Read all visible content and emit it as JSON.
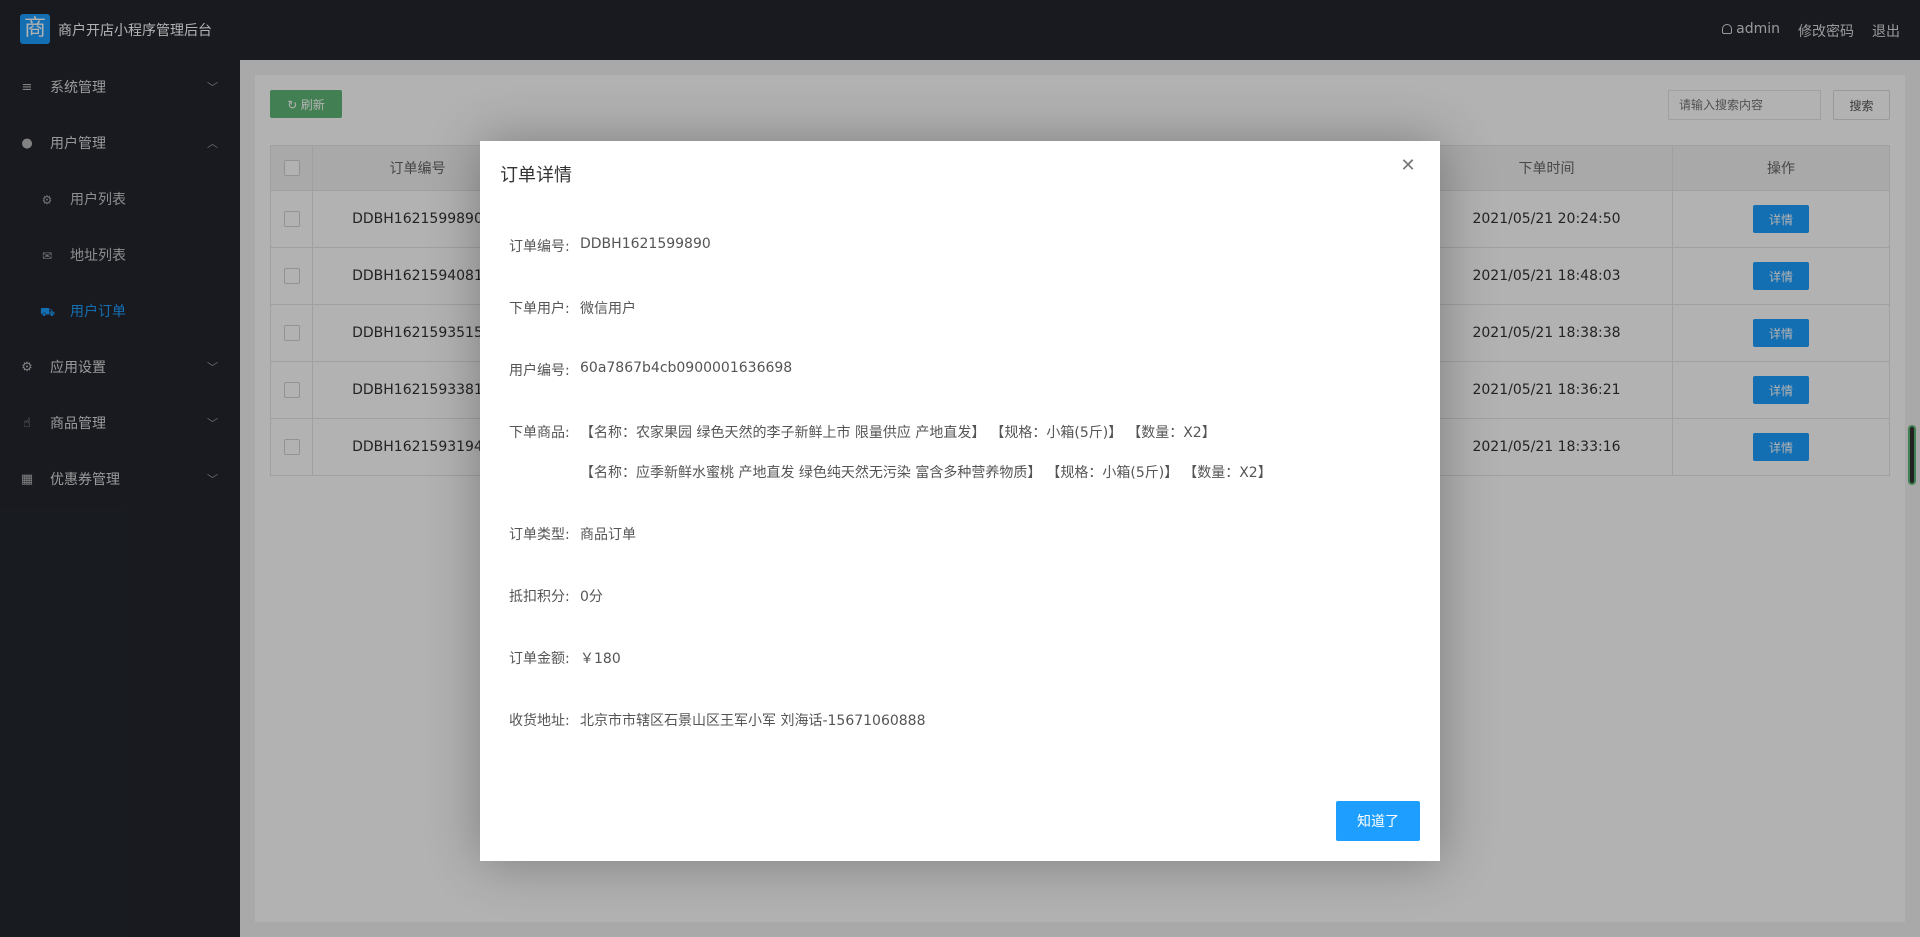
{
  "header": {
    "logo_char": "商",
    "app_title": "商户开店小程序管理后台",
    "user": "admin",
    "change_password": "修改密码",
    "logout": "退出"
  },
  "sidebar": {
    "items": [
      {
        "label": "系统管理",
        "icon": "menu-icon",
        "expanded": false
      },
      {
        "label": "用户管理",
        "icon": "user-circle-icon",
        "expanded": true
      },
      {
        "label": "应用设置",
        "icon": "gear-icon",
        "expanded": false
      },
      {
        "label": "商品管理",
        "icon": "thumbs-up-icon",
        "expanded": false
      },
      {
        "label": "优惠券管理",
        "icon": "map-icon",
        "expanded": false
      }
    ],
    "sub_items": [
      {
        "label": "用户列表",
        "icon": "gear-icon"
      },
      {
        "label": "地址列表",
        "icon": "envelope-icon"
      },
      {
        "label": "用户订单",
        "icon": "cart-icon",
        "active": true
      }
    ]
  },
  "toolbar": {
    "refresh_label": "刷新",
    "search_placeholder": "请输入搜索内容",
    "search_label": "搜索"
  },
  "table": {
    "headers": [
      "订单编号",
      "下单时间",
      "操作"
    ],
    "rows": [
      {
        "order_no": "DDBH1621599890",
        "time": "2021/05/21 20:24:50",
        "action": "详情"
      },
      {
        "order_no": "DDBH1621594081",
        "time": "2021/05/21 18:48:03",
        "action": "详情"
      },
      {
        "order_no": "DDBH1621593515",
        "time": "2021/05/21 18:38:38",
        "action": "详情"
      },
      {
        "order_no": "DDBH1621593381",
        "time": "2021/05/21 18:36:21",
        "action": "详情"
      },
      {
        "order_no": "DDBH1621593194",
        "time": "2021/05/21 18:33:16",
        "action": "详情"
      }
    ]
  },
  "modal": {
    "title": "订单详情",
    "fields": {
      "order_no": {
        "label": "订单编号:",
        "value": "DDBH1621599890"
      },
      "user": {
        "label": "下单用户:",
        "value": "微信用户"
      },
      "user_id": {
        "label": "用户编号:",
        "value": "60a7867b4cb0900001636698"
      },
      "goods_label": "下单商品:",
      "order_type": {
        "label": "订单类型:",
        "value": "商品订单"
      },
      "points": {
        "label": "抵扣积分:",
        "value": "0分"
      },
      "amount": {
        "label": "订单金额:",
        "value": "￥180"
      },
      "address": {
        "label": "收货地址:",
        "value": "北京市市辖区石景山区王军小军 刘海话-15671060888"
      }
    },
    "goods": [
      {
        "name": "【名称：农家果园 绿色天然的李子新鲜上市 限量供应 产地直发】",
        "spec": "【规格：小箱(5斤)】",
        "qty": "【数量：X2】"
      },
      {
        "name": "【名称：应季新鲜水蜜桃 产地直发 绿色纯天然无污染 富含多种营养物质】",
        "spec": "【规格：小箱(5斤)】",
        "qty": "【数量：X2】"
      }
    ],
    "ok_label": "知道了"
  }
}
